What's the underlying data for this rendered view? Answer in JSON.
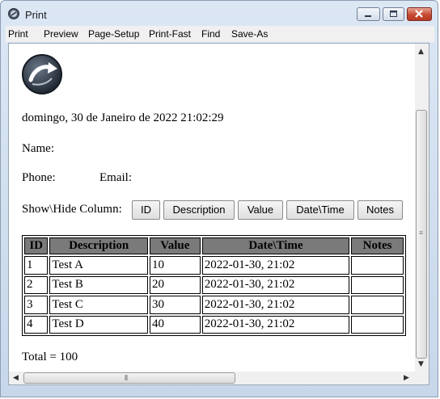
{
  "window": {
    "title": "Print"
  },
  "menu": [
    "Print",
    "Preview",
    "Page-Setup",
    "Print-Fast",
    "Find",
    "Save-As"
  ],
  "page": {
    "date_line": "domingo, 30 de Janeiro de 2022 21:02:29",
    "name_label": "Name:",
    "phone_label": "Phone:",
    "email_label": "Email:",
    "show_hide_label": "Show\\Hide Column:",
    "column_buttons": [
      "ID",
      "Description",
      "Value",
      "Date\\Time",
      "Notes"
    ],
    "table": {
      "headers": [
        "ID",
        "Description",
        "Value",
        "Date\\Time",
        "Notes"
      ],
      "rows": [
        [
          "1",
          "Test A",
          "10",
          "2022-01-30, 21:02",
          ""
        ],
        [
          "2",
          "Test B",
          "20",
          "2022-01-30, 21:02",
          ""
        ],
        [
          "3",
          "Test C",
          "30",
          "2022-01-30, 21:02",
          ""
        ],
        [
          "4",
          "Test D",
          "40",
          "2022-01-30, 21:02",
          ""
        ]
      ]
    },
    "total": "Total = 100"
  }
}
